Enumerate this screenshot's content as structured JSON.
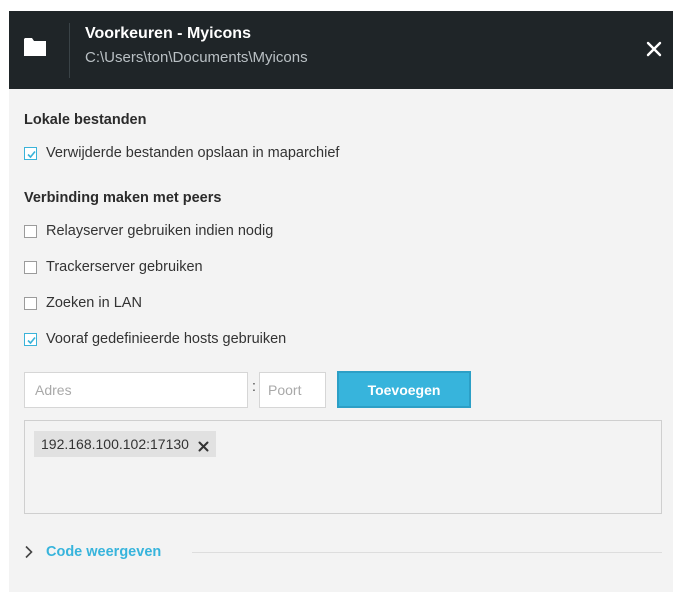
{
  "window": {
    "title": "Voorkeuren - Myicons",
    "path": "C:\\Users\\ton\\Documents\\Myicons",
    "folder_icon": "folder-icon",
    "close_icon": "close-icon"
  },
  "local_files": {
    "heading": "Lokale bestanden",
    "options": [
      {
        "label": "Verwijderde bestanden opslaan in maparchief",
        "checked": true
      }
    ]
  },
  "peers": {
    "heading": "Verbinding maken met peers",
    "options": [
      {
        "label": "Relayserver gebruiken indien nodig",
        "checked": false
      },
      {
        "label": "Trackerserver gebruiken",
        "checked": false
      },
      {
        "label": "Zoeken in LAN",
        "checked": false
      },
      {
        "label": "Vooraf gedefinieerde hosts gebruiken",
        "checked": true
      }
    ],
    "address_placeholder": "Adres",
    "address_value": "",
    "separator": ":",
    "port_placeholder": "Poort",
    "port_value": "",
    "add_button_label": "Toevoegen",
    "hosts": [
      {
        "label": "192.168.100.102:17130",
        "remove_icon": "close-icon"
      }
    ]
  },
  "code_section": {
    "label": "Code weergeven",
    "icon": "chevron-right-icon",
    "expanded": false
  },
  "colors": {
    "titlebar_bg": "#1f2528",
    "accent": "#37b4dc",
    "panel_bg": "#f3f3f3"
  }
}
